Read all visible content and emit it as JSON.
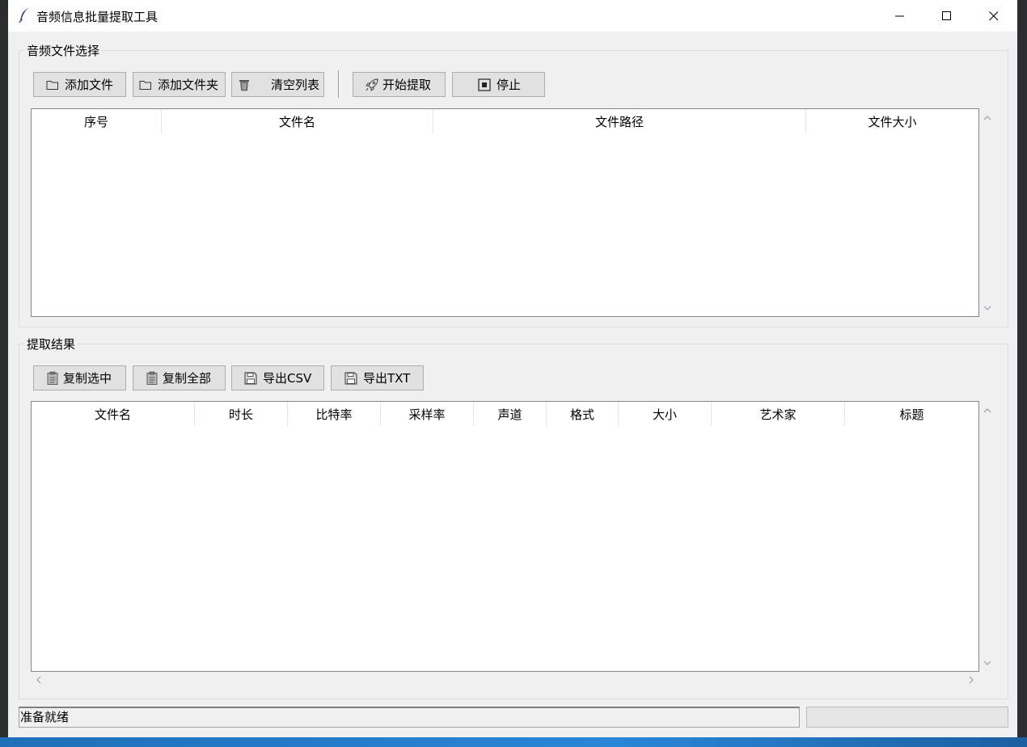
{
  "window": {
    "title": "音频信息批量提取工具",
    "controls": {
      "minimize": "minimize-icon",
      "maximize": "maximize-icon",
      "close": "close-icon"
    }
  },
  "file_section": {
    "label": "音频文件选择",
    "toolbar": {
      "add_file": "添加文件",
      "add_folder": "添加文件夹",
      "clear_list": "清空列表",
      "start_extract": "开始提取",
      "stop": "停止"
    },
    "table": {
      "columns": [
        "序号",
        "文件名",
        "文件路径",
        "文件大小"
      ],
      "rows": []
    }
  },
  "result_section": {
    "label": "提取结果",
    "toolbar": {
      "copy_selected": "复制选中",
      "copy_all": "复制全部",
      "export_csv": "导出CSV",
      "export_txt": "导出TXT"
    },
    "table": {
      "columns": [
        "文件名",
        "时长",
        "比特率",
        "采样率",
        "声道",
        "格式",
        "大小",
        "艺术家",
        "标题"
      ],
      "rows": []
    }
  },
  "status": {
    "text": "准备就绪",
    "progress": 0
  },
  "colors": {
    "window_bg": "#f0f0f0",
    "button_bg": "#e1e1e1",
    "button_border": "#adadad",
    "progress_fill": "#06b025"
  }
}
